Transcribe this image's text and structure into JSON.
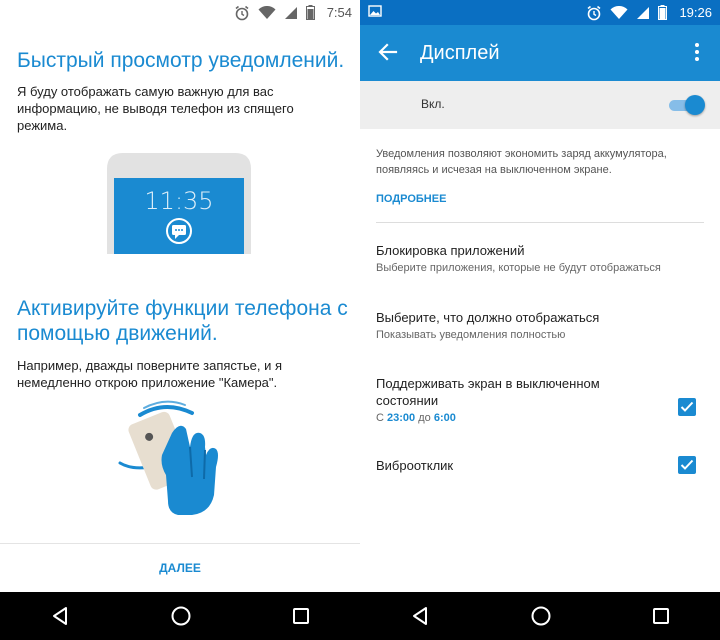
{
  "left": {
    "status_time": "7:54",
    "title1": "Быстрый просмотр уведомлений.",
    "text1": "Я буду отображать самую важную для вас информацию, не выводя телефон из спящего режима.",
    "phone_clock": "11:35",
    "title2": "Активируйте функции телефона с помощью движений.",
    "text2": "Например, дважды поверните запястье, и я немедленно открою приложение \"Камера\".",
    "next_label": "ДАЛЕЕ"
  },
  "right": {
    "status_time": "19:26",
    "appbar_title": "Дисплей",
    "switch_label": "Вкл.",
    "switch_on": true,
    "description": "Уведомления позволяют экономить заряд аккумулятора, появляясь и исчезая на выключенном экране.",
    "more_label": "ПОДРОБНЕЕ",
    "prefs": [
      {
        "title": "Блокировка приложений",
        "subtitle": "Выберите приложения, которые не будут отображаться"
      },
      {
        "title": "Выберите, что должно отображаться",
        "subtitle": "Показывать уведомления полностью"
      },
      {
        "title": "Поддерживать экран в выключенном состоянии",
        "sub_from": "С",
        "time_from": "23:00",
        "sub_to": "до",
        "time_to": "6:00",
        "checked": true
      },
      {
        "title": "Виброотклик",
        "checked": true
      }
    ]
  },
  "colors": {
    "accent": "#1a8ad1",
    "status_dark": "#0a6fc2",
    "navbar": "#000000"
  },
  "icons": [
    "alarm-icon",
    "wifi-icon",
    "signal-icon",
    "battery-icon",
    "image-notification-icon",
    "back-arrow-icon",
    "overflow-menu-icon",
    "nav-back-icon",
    "nav-home-icon",
    "nav-recents-icon",
    "chat-bubble-icon",
    "check-icon"
  ]
}
